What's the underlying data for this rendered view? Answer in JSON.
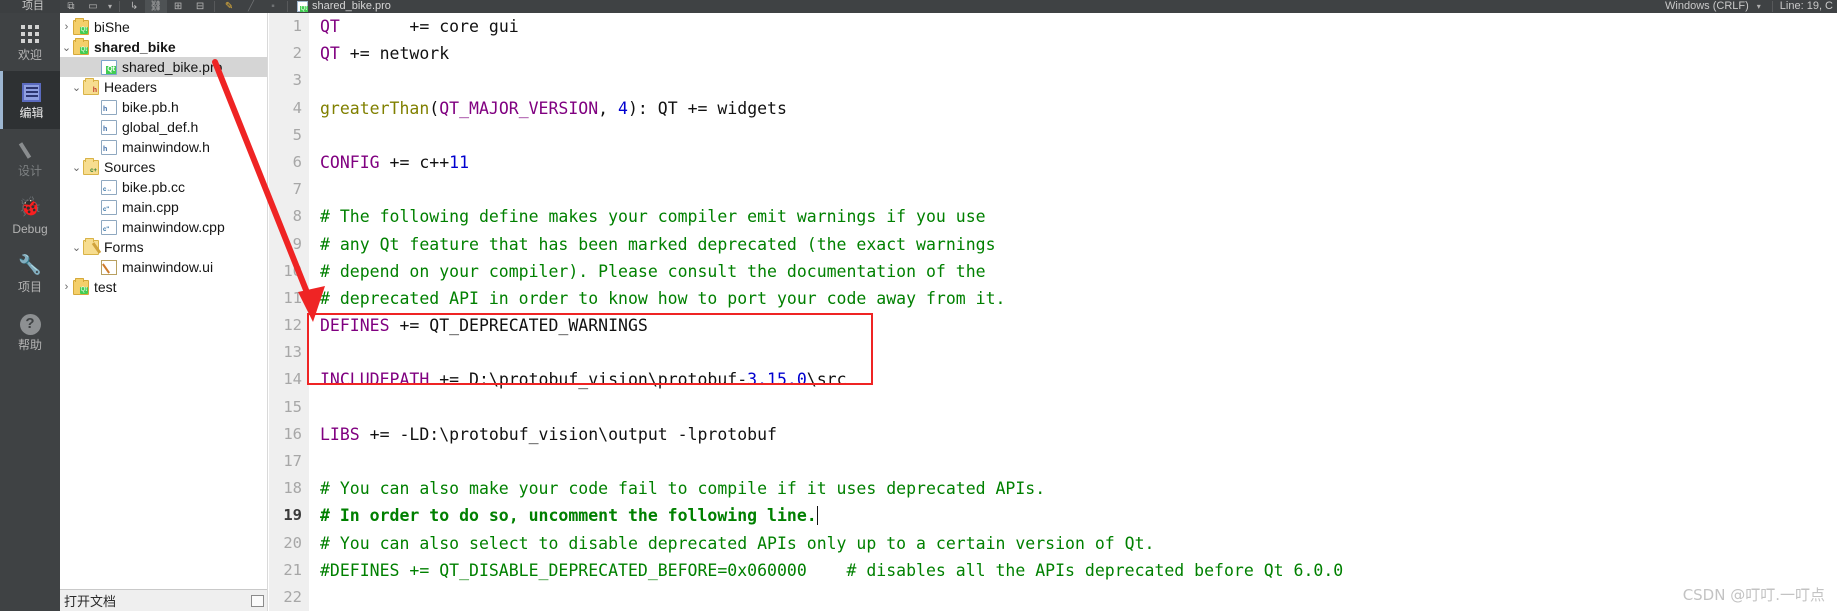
{
  "topbar": {
    "nav_label": "项目",
    "file_tab": "shared_bike.pro",
    "line_ending": "Windows (CRLF)",
    "cursor_status": "Line: 19, C",
    "icons": [
      "split-icon",
      "dropdown-caret-icon",
      "go-back-icon",
      "link-icon",
      "split-horizontal-icon",
      "close-split-icon",
      "bookmark-icon",
      "slash-icon",
      "stop-icon"
    ],
    "close_label": "✕"
  },
  "modebar": {
    "items": [
      {
        "label": "欢迎",
        "icon": "grid-icon",
        "active": false,
        "dim": false
      },
      {
        "label": "编辑",
        "icon": "edit-document-icon",
        "active": true,
        "dim": false
      },
      {
        "label": "设计",
        "icon": "pencil-icon",
        "active": false,
        "dim": true
      },
      {
        "label": "Debug",
        "icon": "bug-icon",
        "active": false,
        "dim": false
      },
      {
        "label": "项目",
        "icon": "wrench-icon",
        "active": false,
        "dim": false
      },
      {
        "label": "帮助",
        "icon": "question-mark-icon",
        "active": false,
        "dim": false
      }
    ]
  },
  "tree": {
    "rows": [
      {
        "label": "biShe",
        "arrow": "›",
        "icon": "folder-qt-icon",
        "indent": 0,
        "bold": false,
        "selected": false
      },
      {
        "label": "shared_bike",
        "arrow": "⌄",
        "icon": "folder-qt-icon",
        "indent": 0,
        "bold": true,
        "selected": false
      },
      {
        "label": "shared_bike.pro",
        "arrow": "",
        "icon": "file-pro-icon",
        "indent": 2,
        "bold": false,
        "selected": true
      },
      {
        "label": "Headers",
        "arrow": "⌄",
        "icon": "folder-h-icon",
        "indent": 1,
        "bold": false,
        "selected": false
      },
      {
        "label": "bike.pb.h",
        "arrow": "",
        "icon": "file-h-icon",
        "indent": 2,
        "bold": false,
        "selected": false
      },
      {
        "label": "global_def.h",
        "arrow": "",
        "icon": "file-h-icon",
        "indent": 2,
        "bold": false,
        "selected": false
      },
      {
        "label": "mainwindow.h",
        "arrow": "",
        "icon": "file-h-icon",
        "indent": 2,
        "bold": false,
        "selected": false
      },
      {
        "label": "Sources",
        "arrow": "⌄",
        "icon": "folder-cpp-icon",
        "indent": 1,
        "bold": false,
        "selected": false
      },
      {
        "label": "bike.pb.cc",
        "arrow": "",
        "icon": "file-cc-icon",
        "indent": 2,
        "bold": false,
        "selected": false
      },
      {
        "label": "main.cpp",
        "arrow": "",
        "icon": "file-cpp-icon",
        "indent": 2,
        "bold": false,
        "selected": false
      },
      {
        "label": "mainwindow.cpp",
        "arrow": "",
        "icon": "file-cpp-icon",
        "indent": 2,
        "bold": false,
        "selected": false
      },
      {
        "label": "Forms",
        "arrow": "⌄",
        "icon": "folder-form-icon",
        "indent": 1,
        "bold": false,
        "selected": false
      },
      {
        "label": "mainwindow.ui",
        "arrow": "",
        "icon": "file-ui-icon",
        "indent": 2,
        "bold": false,
        "selected": false
      },
      {
        "label": "test",
        "arrow": "›",
        "icon": "folder-qt-icon",
        "indent": 0,
        "bold": false,
        "selected": false
      }
    ],
    "footer_label": "打开文档"
  },
  "editor": {
    "file": "shared_bike.pro",
    "current_line": 19,
    "lines": [
      {
        "n": "1",
        "tokens": [
          {
            "t": "QT",
            "c": "k-var"
          },
          {
            "t": "       += core gui",
            "c": "k-plain"
          }
        ]
      },
      {
        "n": "2",
        "tokens": [
          {
            "t": "QT",
            "c": "k-var"
          },
          {
            "t": " += network",
            "c": "k-plain"
          }
        ]
      },
      {
        "n": "3",
        "tokens": []
      },
      {
        "n": "4",
        "tokens": [
          {
            "t": "greaterThan",
            "c": "k-fn"
          },
          {
            "t": "(",
            "c": "k-plain"
          },
          {
            "t": "QT_MAJOR_VERSION",
            "c": "k-macro"
          },
          {
            "t": ", ",
            "c": "k-plain"
          },
          {
            "t": "4",
            "c": "k-num"
          },
          {
            "t": "): QT += widgets",
            "c": "k-plain"
          }
        ]
      },
      {
        "n": "5",
        "tokens": []
      },
      {
        "n": "6",
        "tokens": [
          {
            "t": "CONFIG",
            "c": "k-var"
          },
          {
            "t": " += c++",
            "c": "k-plain"
          },
          {
            "t": "11",
            "c": "k-num"
          }
        ]
      },
      {
        "n": "7",
        "tokens": []
      },
      {
        "n": "8",
        "tokens": [
          {
            "t": "# The following define makes your compiler emit warnings if you use",
            "c": "k-cmt"
          }
        ]
      },
      {
        "n": "9",
        "tokens": [
          {
            "t": "# any Qt feature that has been marked deprecated (the exact warnings",
            "c": "k-cmt"
          }
        ]
      },
      {
        "n": "10",
        "tokens": [
          {
            "t": "# depend on your compiler). Please consult the documentation of the",
            "c": "k-cmt"
          }
        ]
      },
      {
        "n": "11",
        "tokens": [
          {
            "t": "# deprecated API in order to know how to port your code away from it.",
            "c": "k-cmt"
          }
        ]
      },
      {
        "n": "12",
        "tokens": [
          {
            "t": "DEFINES",
            "c": "k-var"
          },
          {
            "t": " += QT_DEPRECATED_WARNINGS",
            "c": "k-plain"
          }
        ]
      },
      {
        "n": "13",
        "tokens": []
      },
      {
        "n": "14",
        "tokens": [
          {
            "t": "INCLUDEPATH",
            "c": "k-var"
          },
          {
            "t": " += D:\\protobuf_vision\\protobuf-",
            "c": "k-plain"
          },
          {
            "t": "3.15.0",
            "c": "k-num"
          },
          {
            "t": "\\src",
            "c": "k-plain"
          }
        ]
      },
      {
        "n": "15",
        "tokens": []
      },
      {
        "n": "16",
        "tokens": [
          {
            "t": "LIBS",
            "c": "k-var"
          },
          {
            "t": " += -LD:\\protobuf_vision\\output -lprotobuf",
            "c": "k-plain"
          }
        ]
      },
      {
        "n": "17",
        "tokens": []
      },
      {
        "n": "18",
        "tokens": [
          {
            "t": "# You can also make your code fail to compile if it uses deprecated APIs.",
            "c": "k-cmt"
          }
        ]
      },
      {
        "n": "19",
        "tokens": [
          {
            "t": "# In order to do so, uncomment the following line.",
            "c": "k-cmt"
          }
        ],
        "caret": true,
        "current": true
      },
      {
        "n": "20",
        "tokens": [
          {
            "t": "# You can also select to disable deprecated APIs only up to a certain version of Qt.",
            "c": "k-cmt"
          }
        ]
      },
      {
        "n": "21",
        "tokens": [
          {
            "t": "#DEFINES += QT_DISABLE_DEPRECATED_BEFORE=0x060000    # disables all the APIs deprecated before Qt 6.0.0",
            "c": "k-cmt"
          }
        ]
      },
      {
        "n": "22",
        "tokens": []
      }
    ]
  },
  "annotations": {
    "box_color": "#ef2424",
    "arrow_color": "#ef2424",
    "arrow_label": "red-arrow-pointing-to-includepath"
  },
  "watermark": {
    "text": "CSDN @叮叮.一叮点"
  }
}
